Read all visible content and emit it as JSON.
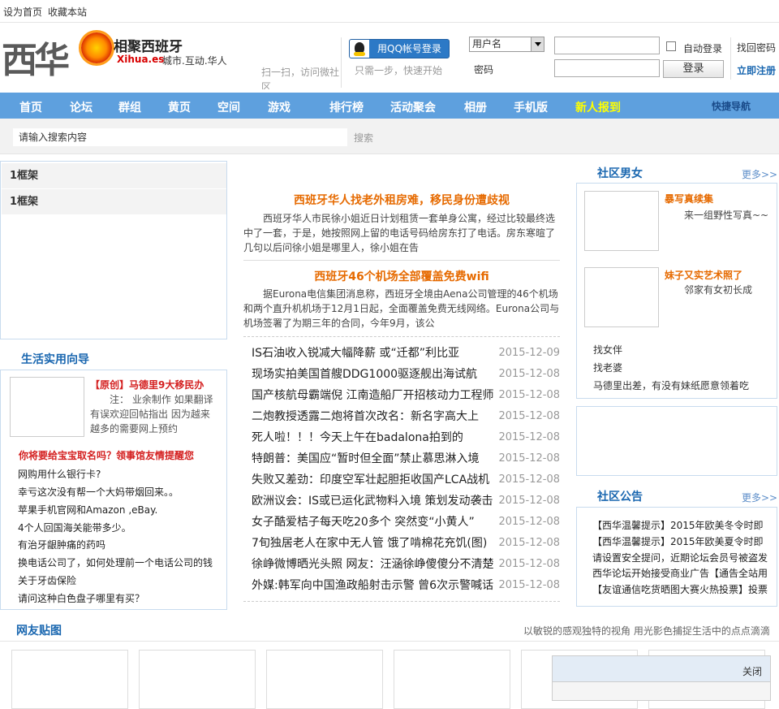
{
  "topbar": {
    "home": "设为首页",
    "fav": "收藏本站"
  },
  "logo": {
    "main": "西华",
    "slogan": "相聚西班牙",
    "domain": "Xihua.es",
    "tagline": "城市.互动.华人"
  },
  "scan_text": "扫一扫，访问微社区",
  "login": {
    "qq_button": "用QQ帐号登录",
    "qq_sub": "只需一步，快速开始",
    "user_select": "用户名",
    "pwd_label": "密码",
    "auto_login": "自动登录",
    "login_button": "登录",
    "forgot": "找回密码",
    "register": "立即注册"
  },
  "nav": {
    "items": [
      "首页",
      "论坛",
      "群组",
      "黄页",
      "空间",
      "游戏",
      "排行榜",
      "活动聚会",
      "相册",
      "手机版",
      "新人报到"
    ],
    "quick": "快捷导航"
  },
  "search": {
    "placeholder": "请输入搜索内容",
    "button": "搜索"
  },
  "frames": [
    "1框架",
    "1框架"
  ],
  "life": {
    "title": "生活实用向导",
    "feature_title": "【原创】马德里9大移民办",
    "feature_body": "注：  业余制作 如果翻译有误欢迎回帖指出 因为越来越多的需要网上预约",
    "hot_title": "你将要给宝宝取名吗？领事馆友情提醒您",
    "items": [
      "网购用什么银行卡?",
      "幸亏这次没有帮一个大妈带烟回来。。",
      "苹果手机官网和Amazon ,eBay.",
      "4个人回国海关能带多少。",
      "有治牙龈肿痛的药吗",
      "换电话公司了，如何处理前一个电话公司的钱",
      "关于牙齿保险",
      "请问这种白色盘子哪里有买？"
    ]
  },
  "news": [
    {
      "title": "西班牙华人找老外租房难，移民身份遭歧视",
      "body": "西班牙华人市民徐小姐近日计划租赁一套单身公寓，经过比较最终选中了一套，于是，她按照网上留的电话号码给房东打了电话。房东寒暄了几句以后问徐小姐是哪里人，徐小姐在告"
    },
    {
      "title": "西班牙46个机场全部覆盖免费wifi",
      "body": "据Eurona电信集团消息称，西班牙全境由Aena公司管理的46个机场和两个直升机机场于12月1日起，全面覆盖免费无线网络。Eurona公司与机场签署了为期三年的合同，今年9月，该公"
    }
  ],
  "list": [
    {
      "title": "IS石油收入锐减大幅降薪 或“迁都”利比亚",
      "date": "2015-12-09"
    },
    {
      "title": "现场实拍美国首艘DDG1000驱逐舰出海试航",
      "date": "2015-12-08"
    },
    {
      "title": "国产核航母霸端倪 江南造船厂开招核动力工程师",
      "date": "2015-12-08"
    },
    {
      "title": "二炮教授透露二炮将首次改名：新名字高大上",
      "date": "2015-12-08"
    },
    {
      "title": "死人啦！！！今天上午在badalona拍到的",
      "date": "2015-12-08"
    },
    {
      "title": "特朗普：美国应“暂时但全面”禁止慕思淋入境",
      "date": "2015-12-08"
    },
    {
      "title": "失败又差劲：印度空军壮起胆拒收国产LCA战机",
      "date": "2015-12-08"
    },
    {
      "title": "欧洲议会：IS或已运化武物料入境 策划发动袭击",
      "date": "2015-12-08"
    },
    {
      "title": "女子酷爱桔子每天吃20多个 突然变“小黄人”",
      "date": "2015-12-08"
    },
    {
      "title": "7旬独居老人在家中无人管 饿了啃棉花充饥(图)",
      "date": "2015-12-08"
    },
    {
      "title": "徐峥微博晒光头照 网友：汪涵徐峥傻傻分不清楚",
      "date": "2015-12-08"
    },
    {
      "title": "外媒:韩军向中国渔政船射击示警 曾6次示警喊话",
      "date": "2015-12-08"
    }
  ],
  "social": {
    "title": "社区男女",
    "more": "更多>>",
    "cards": [
      {
        "title": "暴写真续集",
        "sub": "来一组野性写真~~"
      },
      {
        "title": "妹子又实艺术照了",
        "sub": "邻家有女初长成"
      }
    ],
    "links": [
      "找女伴",
      "找老婆",
      "马德里出差，有没有妹纸愿意领着吃"
    ]
  },
  "announce": {
    "title": "社区公告",
    "more": "更多>>",
    "items": [
      "【西华温馨提示】2015年欧美冬令时即",
      "【西华温馨提示】2015年欧美夏令时即",
      "请设置安全提问，近期论坛会员号被盗发",
      "西华论坛开始接受商业广告【通告全站用",
      "【友谊通信吃货晒图大赛火热投票】投票"
    ]
  },
  "gallery": {
    "title": "网友贴图",
    "tagline": "以敏锐的感观独特的视角 用光影色捕捉生活中的点点滴滴"
  },
  "popup": {
    "close": "关闭"
  }
}
